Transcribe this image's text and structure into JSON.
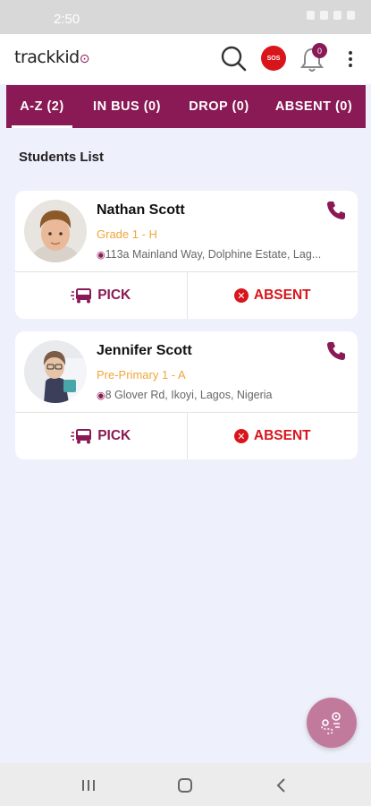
{
  "status_bar": {
    "time": "2:50"
  },
  "header": {
    "logo_text": "trackkid",
    "sos_label": "SOS",
    "notification_count": "0"
  },
  "tabs": [
    {
      "label": "A-Z (2)",
      "active": true
    },
    {
      "label": "IN BUS (0)",
      "active": false
    },
    {
      "label": "DROP (0)",
      "active": false
    },
    {
      "label": "ABSENT (0)",
      "active": false
    }
  ],
  "section_title": "Students List",
  "students": [
    {
      "name": "Nathan Scott",
      "grade": "Grade 1 - H",
      "address": "113a Mainland Way, Dolphine Estate, Lag...",
      "pick_label": "PICK",
      "absent_label": "ABSENT"
    },
    {
      "name": "Jennifer Scott",
      "grade": "Pre-Primary 1 - A",
      "address": "8 Glover Rd, Ikoyi, Lagos, Nigeria",
      "pick_label": "PICK",
      "absent_label": "ABSENT"
    }
  ],
  "colors": {
    "brand": "#8a1a55",
    "grade": "#f0a53a",
    "absent": "#d9151c",
    "background": "#eef0fb"
  },
  "icons": [
    "search-icon",
    "bell-icon",
    "more-vert-icon",
    "phone-icon",
    "bus-icon",
    "close-circle-icon",
    "location-pin-icon",
    "route-icon"
  ]
}
